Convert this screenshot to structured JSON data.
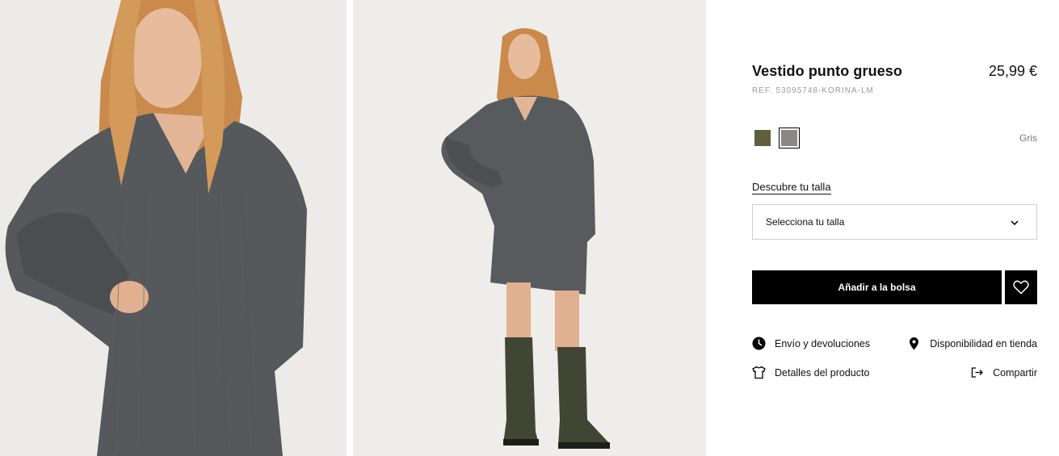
{
  "product": {
    "title": "Vestido punto grueso",
    "price": "25,99 €",
    "reference": "REF. 53095748-KORINA-LM"
  },
  "colors": {
    "swatches": [
      {
        "name": "khaki-swatch",
        "hex": "#5f5f3e"
      },
      {
        "name": "grey-swatch",
        "hex": "#8a8786"
      }
    ],
    "selected_label": "Gris"
  },
  "size": {
    "guide_link": "Descubre tu talla",
    "select_label": "Selecciona tu talla"
  },
  "actions": {
    "add_to_bag": "Añadir a la bolsa",
    "shipping": "Envío y devoluciones",
    "store_availability": "Disponibilidad en tienda",
    "product_details": "Detalles del producto",
    "share": "Compartir"
  },
  "theme": {
    "photo_background": "#eeede9",
    "button_color": "#000000"
  }
}
